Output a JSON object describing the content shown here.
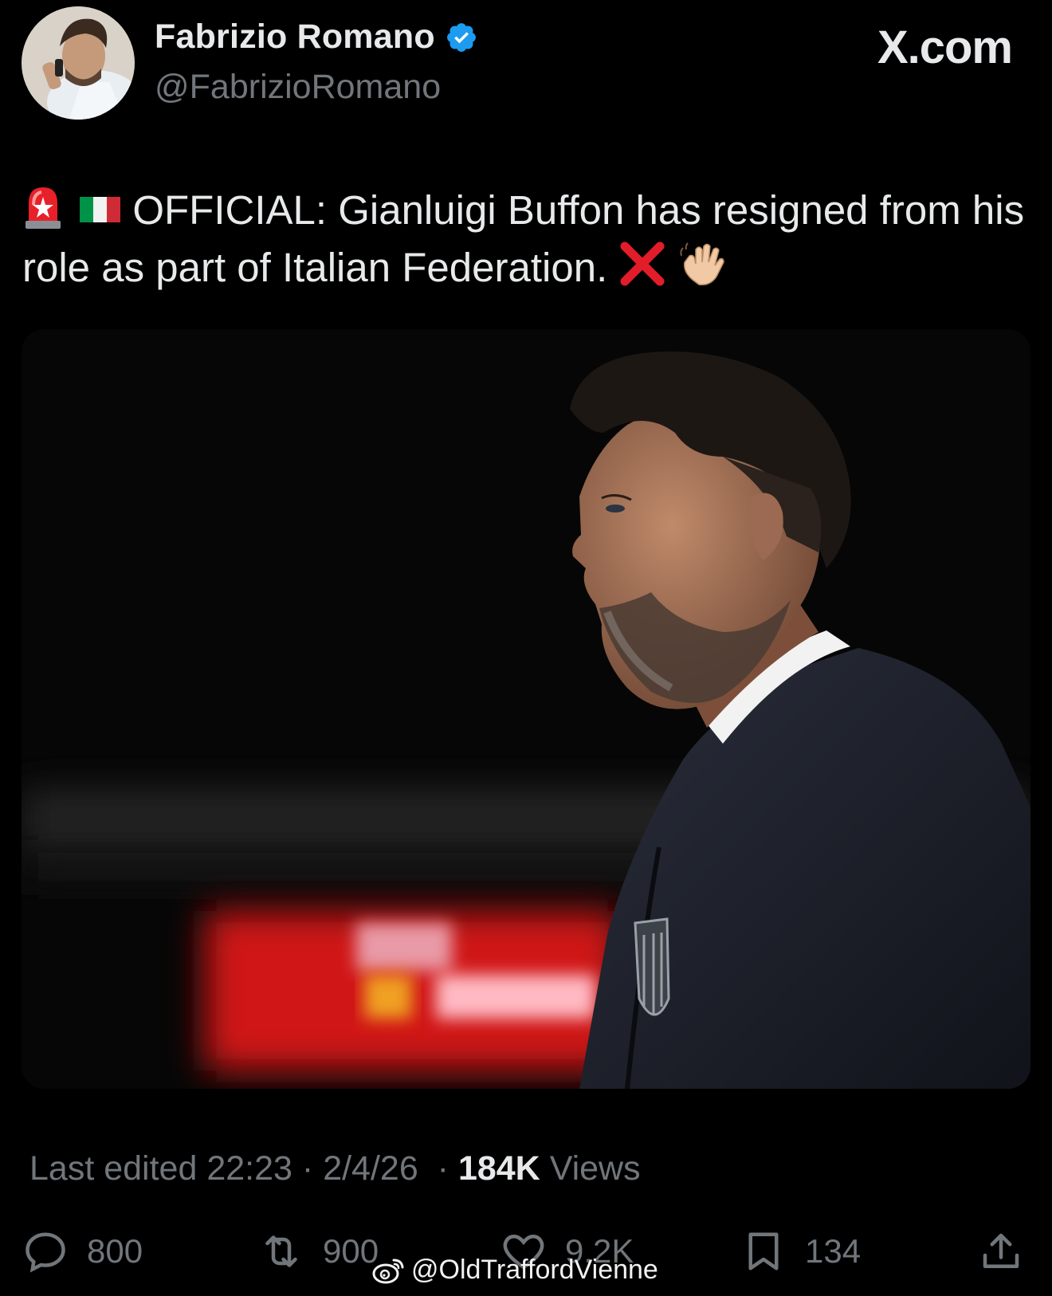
{
  "author": {
    "display_name": "Fabrizio Romano",
    "handle": "@FabrizioRomano",
    "verified": true,
    "verified_color": "#1d9bf0"
  },
  "brand": "X.com",
  "tweet": {
    "emojis_lead": [
      "rotating-light-emoji",
      "italy-flag-emoji"
    ],
    "text": "OFFICIAL: Gianluigi Buffon has resigned from his role as part of Italian Federation.",
    "emojis_trail": [
      "red-cross-emoji",
      "waving-hand-emoji"
    ]
  },
  "media": {
    "description_icon": "photo"
  },
  "meta": {
    "edited_prefix": "Last edited",
    "time": "22:23",
    "date": "2/4/26",
    "views_count": "184K",
    "views_label": "Views"
  },
  "actions": {
    "replies": "800",
    "reposts": "900",
    "likes": "9.2K",
    "bookmarks": "134"
  },
  "watermark": "@OldTraffordVienne",
  "colors": {
    "background": "#000000",
    "text": "#e7e9ea",
    "secondary": "#71767b"
  }
}
